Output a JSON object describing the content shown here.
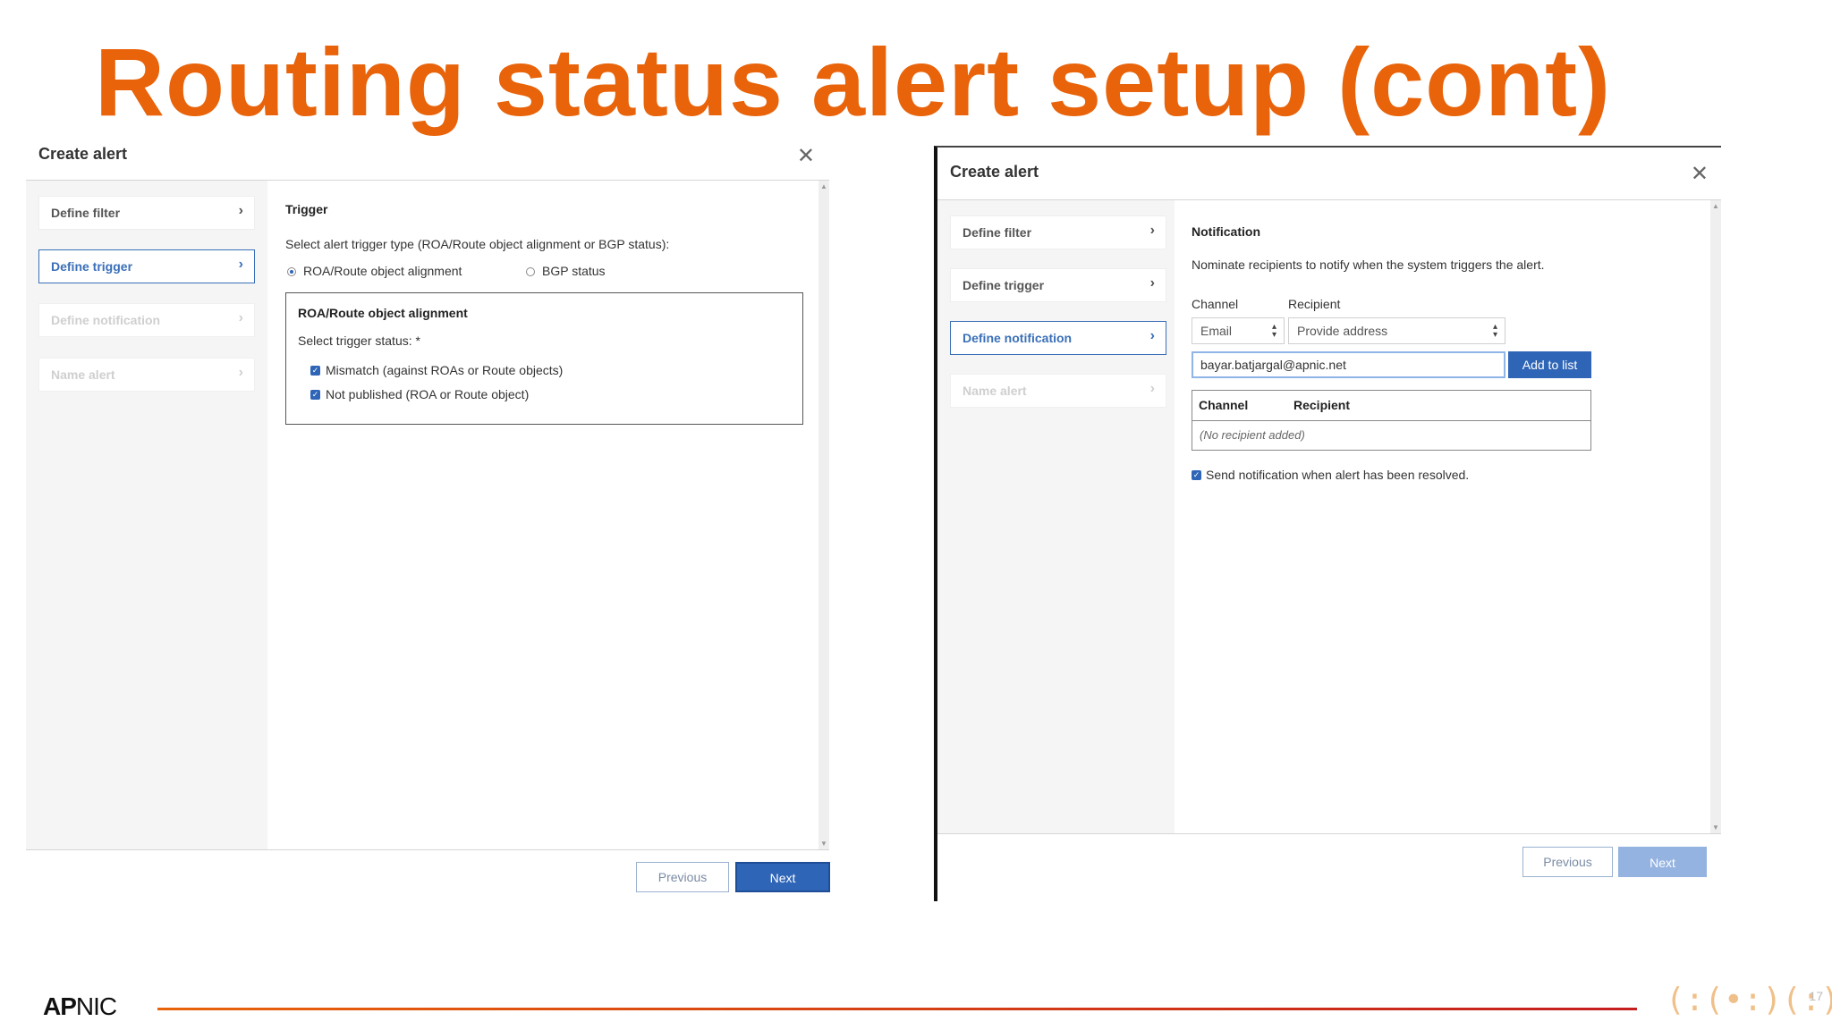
{
  "slide": {
    "title": "Routing status alert setup (cont)",
    "logo_bold": "AP",
    "logo_rest": "NIC",
    "page_number": "17",
    "decoration": "(:(•:)(:):)"
  },
  "left_dialog": {
    "title": "Create alert",
    "close_glyph": "✕",
    "steps": [
      {
        "label": "Define filter",
        "state": "normal"
      },
      {
        "label": "Define trigger",
        "state": "active"
      },
      {
        "label": "Define notification",
        "state": "disabled"
      },
      {
        "label": "Name alert",
        "state": "disabled"
      }
    ],
    "chevron": "›",
    "section_title": "Trigger",
    "prompt": "Select alert trigger type (ROA/Route object alignment or BGP status):",
    "radio_options": [
      {
        "label": "ROA/Route object alignment",
        "selected": true
      },
      {
        "label": "BGP status",
        "selected": false
      }
    ],
    "box_title": "ROA/Route object alignment",
    "status_prompt": "Select trigger status: *",
    "checkboxes": [
      {
        "label": "Mismatch (against ROAs or Route objects)",
        "checked": true
      },
      {
        "label": "Not published (ROA or Route object)",
        "checked": true
      }
    ],
    "previous_label": "Previous",
    "next_label": "Next"
  },
  "right_dialog": {
    "title": "Create alert",
    "close_glyph": "✕",
    "steps": [
      {
        "label": "Define filter",
        "state": "normal"
      },
      {
        "label": "Define trigger",
        "state": "normal"
      },
      {
        "label": "Define notification",
        "state": "active"
      },
      {
        "label": "Name alert",
        "state": "disabled"
      }
    ],
    "chevron": "›",
    "section_title": "Notification",
    "prompt": "Nominate recipients to notify when the system triggers the alert.",
    "channel_label": "Channel",
    "recipient_label": "Recipient",
    "channel_value": "Email",
    "recipient_value": "Provide address",
    "address_value": "bayar.batjargal@apnic.net",
    "add_button": "Add to list",
    "table_headers": [
      "Channel",
      "Recipient"
    ],
    "table_empty": "(No recipient added)",
    "resolved_checkbox": {
      "label": "Send notification when alert has been resolved.",
      "checked": true
    },
    "previous_label": "Previous",
    "next_label": "Next"
  },
  "colors": {
    "title_orange": "#e8630a",
    "accent_blue": "#2f65b7",
    "line_end_red": "#c41e1e"
  }
}
